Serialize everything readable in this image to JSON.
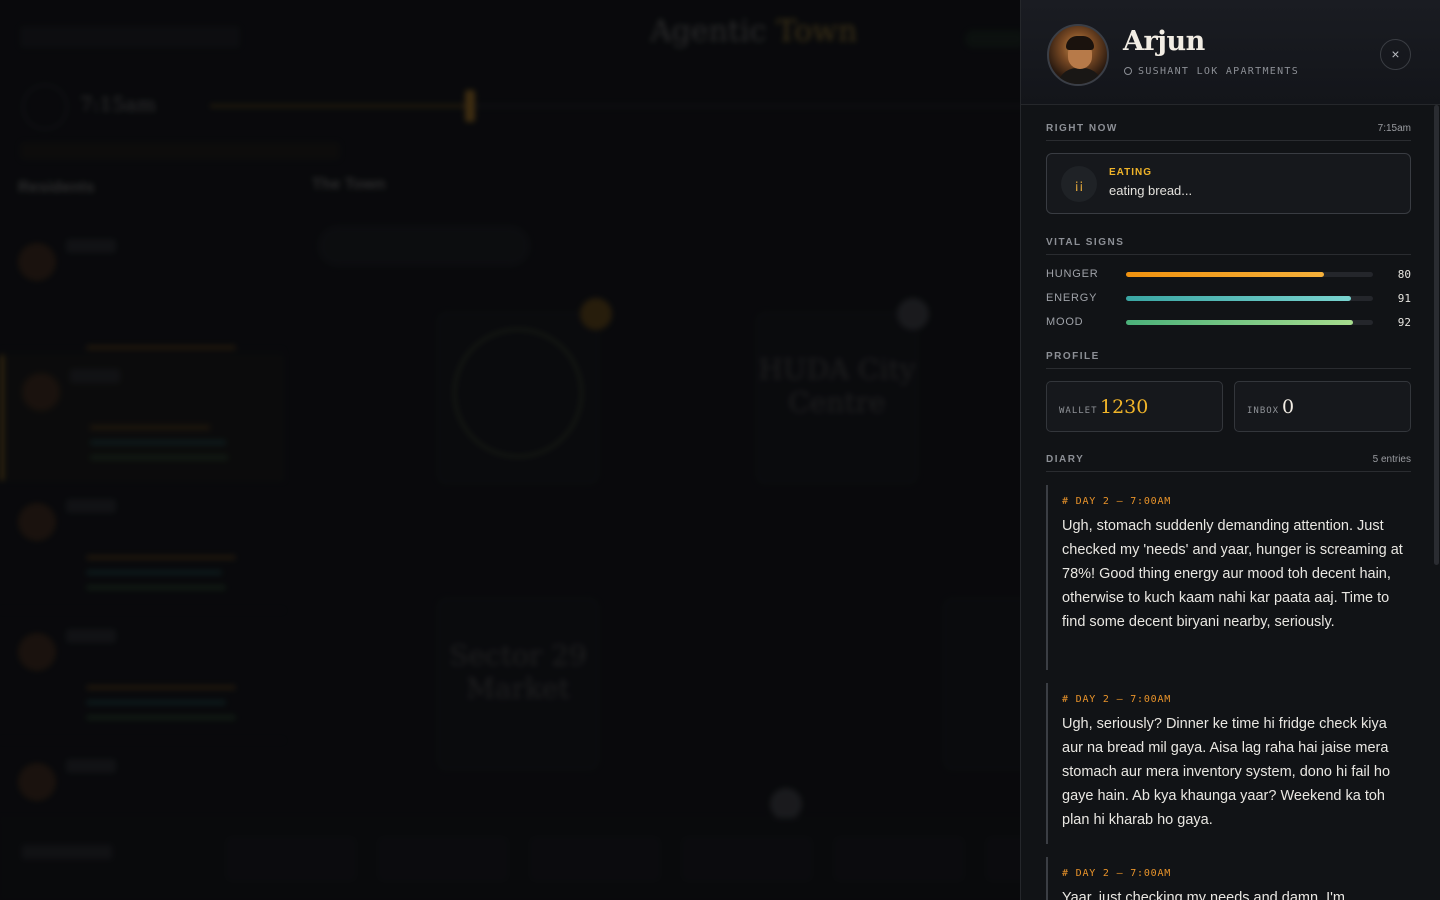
{
  "background": {
    "app_title": "Agentic",
    "app_title_accent": "Town",
    "time": "7:15am",
    "sidebar_heading": "Residents",
    "main_heading": "The Town",
    "follow_label": "Following: Deepa",
    "cards": [
      "Sector 29 Market",
      "HUDA City Centre"
    ]
  },
  "drawer": {
    "resident_name": "Arjun",
    "home": "SUSHANT LOK APARTMENTS",
    "close_icon": "×",
    "right_now": {
      "heading": "RIGHT NOW",
      "time": "7:15am",
      "activity_icon": "fork-knife-icon",
      "activity_glyph": "¡¡",
      "activity_kind": "EATING",
      "activity_desc": "eating bread..."
    },
    "vitals": {
      "heading": "VITAL SIGNS",
      "items": [
        {
          "label": "HUNGER",
          "value": 80,
          "color": "#f0920f",
          "color2": "#f5b03a"
        },
        {
          "label": "ENERGY",
          "value": 91,
          "color": "#3aa6a3",
          "color2": "#79d3cf"
        },
        {
          "label": "MOOD",
          "value": 92,
          "color": "#4bb17a",
          "color2": "#a7dc8e"
        }
      ]
    },
    "profile": {
      "heading": "PROFILE",
      "wallet_label": "WALLET",
      "wallet_value": "1230",
      "inbox_label": "INBOX",
      "inbox_value": "0"
    },
    "diary": {
      "heading": "DIARY",
      "count": "5 entries",
      "entries": [
        {
          "stamp": "# DAY 2 — 7:00AM",
          "text": "Ugh, stomach suddenly demanding attention. Just checked my 'needs' and yaar, hunger is screaming at 78%! Good thing energy aur mood toh decent hain, otherwise to kuch kaam nahi kar paata aaj. Time to find some decent biryani nearby, seriously."
        },
        {
          "stamp": "# DAY 2 — 7:00AM",
          "text": "Ugh, seriously? Dinner ke time hi fridge check kiya aur na bread mil gaya. Aisa lag raha hai jaise mera stomach aur mera inventory system, dono hi fail ho gaye hain. Ab kya khaunga yaar? Weekend ka toh plan hi kharab ho gaya."
        },
        {
          "stamp": "# DAY 2 — 7:00AM",
          "text": "Yaar, just checking my needs and damn, I'm"
        }
      ]
    }
  },
  "colors": {
    "accent": "#f0b429",
    "diary_stamp": "#e8932a",
    "wallet": "#f0b429",
    "inbox": "#f2ede4"
  }
}
